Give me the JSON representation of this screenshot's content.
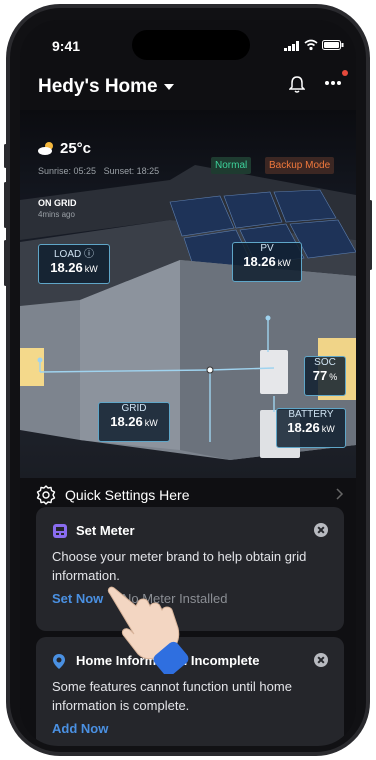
{
  "status_bar": {
    "time": "9:41"
  },
  "header": {
    "title": "Hedy's Home"
  },
  "weather": {
    "temp": "25°c",
    "sunrise": "Sunrise: 05:25",
    "sunset": "Sunset: 18:25"
  },
  "modes": {
    "normal": "Normal",
    "backup": "Backup Mode"
  },
  "grid_status": {
    "label": "ON GRID",
    "updated": "4mins ago"
  },
  "metrics": {
    "load": {
      "label": "LOAD ⓘ",
      "value": "18.26",
      "unit": "kW"
    },
    "pv": {
      "label": "PV",
      "value": "18.26",
      "unit": "kW"
    },
    "soc": {
      "label": "SOC",
      "value": "77",
      "unit": "%"
    },
    "grid": {
      "label": "GRID",
      "value": "18.26",
      "unit": "kW"
    },
    "battery": {
      "label": "BATTERY",
      "value": "18.26",
      "unit": "kW"
    }
  },
  "quick_settings": {
    "label": "Quick Settings Here"
  },
  "cards": [
    {
      "title": "Set Meter",
      "description": "Choose your meter brand to help obtain grid information.",
      "action": "Set Now",
      "status": "No Meter Installed",
      "icon": "meter-icon"
    },
    {
      "title": "Home Information Incomplete",
      "description": "Some features cannot function until home information is complete.",
      "action": "Add Now",
      "icon": "location-pin-icon"
    }
  ],
  "colors": {
    "accent": "#4a90e2",
    "normal": "#3dd29b",
    "backup": "#f0783c",
    "card_bg": "#25262b",
    "flow_line": "#5fa6c8"
  }
}
